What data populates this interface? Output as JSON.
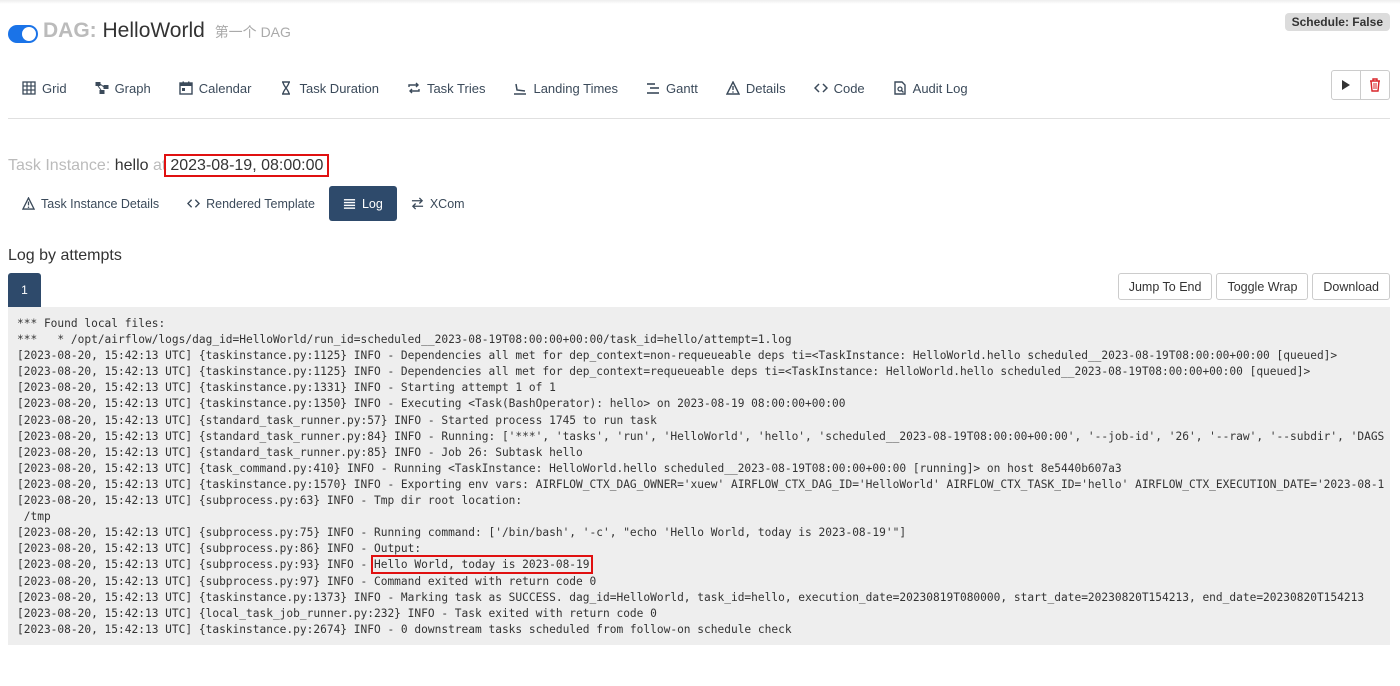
{
  "header": {
    "dag_label": "DAG:",
    "dag_id": "HelloWorld",
    "dag_description": "第一个 DAG",
    "schedule_badge": "Schedule: False",
    "pause_toggle_on": true
  },
  "nav_tabs": [
    {
      "label": "Grid",
      "icon": "grid-icon"
    },
    {
      "label": "Graph",
      "icon": "graph-icon"
    },
    {
      "label": "Calendar",
      "icon": "calendar-icon"
    },
    {
      "label": "Task Duration",
      "icon": "hourglass-icon"
    },
    {
      "label": "Task Tries",
      "icon": "retry-icon"
    },
    {
      "label": "Landing Times",
      "icon": "landing-icon"
    },
    {
      "label": "Gantt",
      "icon": "gantt-icon"
    },
    {
      "label": "Details",
      "icon": "warning-icon"
    },
    {
      "label": "Code",
      "icon": "code-icon"
    },
    {
      "label": "Audit Log",
      "icon": "audit-log-icon"
    }
  ],
  "task_instance": {
    "label": "Task Instance:",
    "task_id": "hello",
    "at": "at",
    "logical_date": "2023-08-19, 08:00:00"
  },
  "sub_tabs": [
    {
      "label": "Task Instance Details",
      "icon": "warning-icon",
      "active": false
    },
    {
      "label": "Rendered Template",
      "icon": "code-icon",
      "active": false
    },
    {
      "label": "Log",
      "icon": "list-icon",
      "active": true
    },
    {
      "label": "XCom",
      "icon": "exchange-icon",
      "active": false
    }
  ],
  "log": {
    "heading": "Log by attempts",
    "attempt": "1",
    "buttons": {
      "jump": "Jump To End",
      "wrap": "Toggle Wrap",
      "download": "Download"
    },
    "lines": {
      "l1": "*** Found local files:",
      "l2": "***   * /opt/airflow/logs/dag_id=HelloWorld/run_id=scheduled__2023-08-19T08:00:00+00:00/task_id=hello/attempt=1.log",
      "l3": "[2023-08-20, 15:42:13 UTC] {taskinstance.py:1125} INFO - Dependencies all met for dep_context=non-requeueable deps ti=<TaskInstance: HelloWorld.hello scheduled__2023-08-19T08:00:00+00:00 [queued]>",
      "l4": "[2023-08-20, 15:42:13 UTC] {taskinstance.py:1125} INFO - Dependencies all met for dep_context=requeueable deps ti=<TaskInstance: HelloWorld.hello scheduled__2023-08-19T08:00:00+00:00 [queued]>",
      "l5": "[2023-08-20, 15:42:13 UTC] {taskinstance.py:1331} INFO - Starting attempt 1 of 1",
      "l6": "[2023-08-20, 15:42:13 UTC] {taskinstance.py:1350} INFO - Executing <Task(BashOperator): hello> on 2023-08-19 08:00:00+00:00",
      "l7": "[2023-08-20, 15:42:13 UTC] {standard_task_runner.py:57} INFO - Started process 1745 to run task",
      "l8": "[2023-08-20, 15:42:13 UTC] {standard_task_runner.py:84} INFO - Running: ['***', 'tasks', 'run', 'HelloWorld', 'hello', 'scheduled__2023-08-19T08:00:00+00:00', '--job-id', '26', '--raw', '--subdir', 'DAGS",
      "l9": "[2023-08-20, 15:42:13 UTC] {standard_task_runner.py:85} INFO - Job 26: Subtask hello",
      "l10": "[2023-08-20, 15:42:13 UTC] {task_command.py:410} INFO - Running <TaskInstance: HelloWorld.hello scheduled__2023-08-19T08:00:00+00:00 [running]> on host 8e5440b607a3",
      "l11": "[2023-08-20, 15:42:13 UTC] {taskinstance.py:1570} INFO - Exporting env vars: AIRFLOW_CTX_DAG_OWNER='xuew' AIRFLOW_CTX_DAG_ID='HelloWorld' AIRFLOW_CTX_TASK_ID='hello' AIRFLOW_CTX_EXECUTION_DATE='2023-08-1",
      "l12": "[2023-08-20, 15:42:13 UTC] {subprocess.py:63} INFO - Tmp dir root location:",
      "l13": " /tmp",
      "l14": "[2023-08-20, 15:42:13 UTC] {subprocess.py:75} INFO - Running command: ['/bin/bash', '-c', \"echo 'Hello World, today is 2023-08-19'\"]",
      "l15": "[2023-08-20, 15:42:13 UTC] {subprocess.py:86} INFO - Output:",
      "l16_prefix": "[2023-08-20, 15:42:13 UTC] {subprocess.py:93} INFO - ",
      "l16_output": "Hello World, today is 2023-08-19",
      "l17": "[2023-08-20, 15:42:13 UTC] {subprocess.py:97} INFO - Command exited with return code 0",
      "l18": "[2023-08-20, 15:42:13 UTC] {taskinstance.py:1373} INFO - Marking task as SUCCESS. dag_id=HelloWorld, task_id=hello, execution_date=20230819T080000, start_date=20230820T154213, end_date=20230820T154213",
      "l19": "[2023-08-20, 15:42:13 UTC] {local_task_job_runner.py:232} INFO - Task exited with return code 0",
      "l20": "[2023-08-20, 15:42:13 UTC] {taskinstance.py:2674} INFO - 0 downstream tasks scheduled from follow-on schedule check"
    }
  },
  "colors": {
    "accent": "#1a73e8",
    "active_tab": "#2e4a6b",
    "highlight": "#e01010"
  }
}
